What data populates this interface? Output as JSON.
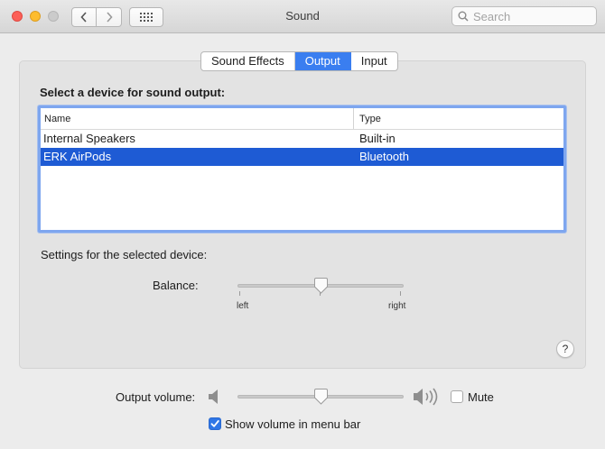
{
  "window": {
    "title": "Sound",
    "search_placeholder": "Search"
  },
  "tabs": [
    {
      "label": "Sound Effects",
      "active": false
    },
    {
      "label": "Output",
      "active": true
    },
    {
      "label": "Input",
      "active": false
    }
  ],
  "output": {
    "heading": "Select a device for sound output:",
    "columns": [
      "Name",
      "Type"
    ],
    "devices": [
      {
        "name": "Internal Speakers",
        "type": "Built-in",
        "selected": false
      },
      {
        "name": "ERK AirPods",
        "type": "Bluetooth",
        "selected": true
      }
    ],
    "settings_label": "Settings for the selected device:",
    "balance": {
      "label": "Balance:",
      "left_label": "left",
      "right_label": "right",
      "value": 0.5
    }
  },
  "bottom": {
    "output_volume_label": "Output volume:",
    "volume_value": 0.5,
    "mute_label": "Mute",
    "mute_checked": false,
    "show_volume_label": "Show volume in menu bar",
    "show_volume_checked": true
  },
  "help_label": "?",
  "colors": {
    "accent": "#3a7ef0",
    "selection": "#1e5bd4",
    "close": "#fc5f57",
    "minimize": "#fdbc2e"
  },
  "icons": [
    "close-icon",
    "minimize-icon",
    "maximize-icon",
    "chevron-left-icon",
    "chevron-right-icon",
    "grid-icon",
    "search-icon",
    "speaker-low-icon",
    "speaker-high-icon",
    "checkmark-icon"
  ]
}
